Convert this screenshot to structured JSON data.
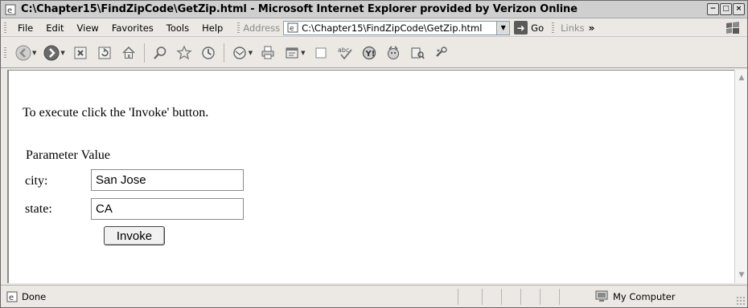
{
  "window": {
    "title": "C:\\Chapter15\\FindZipCode\\GetZip.html - Microsoft Internet Explorer provided by Verizon Online",
    "minimize_glyph": "−",
    "maximize_glyph": "□",
    "close_glyph": "×"
  },
  "menu": {
    "items": [
      "File",
      "Edit",
      "View",
      "Favorites",
      "Tools",
      "Help"
    ],
    "address_label": "Address",
    "address_value": "C:\\Chapter15\\FindZipCode\\GetZip.html",
    "go_label": "Go",
    "links_label": "Links",
    "more_glyph": "»"
  },
  "toolbar": {
    "buttons": [
      "back-icon",
      "forward-icon",
      "stop-icon",
      "refresh-icon",
      "home-icon",
      "search-icon",
      "favorites-icon",
      "history-icon",
      "mail-icon",
      "print-icon",
      "edit-icon",
      "discuss-icon",
      "spelling-icon",
      "messenger-icon",
      "yahoo-icon",
      "research-icon",
      "tools-icon"
    ]
  },
  "page": {
    "intro": "To execute click the 'Invoke' button.",
    "header_parameter": "Parameter",
    "header_value": "Value",
    "params": [
      {
        "label": "city:",
        "value": "San Jose"
      },
      {
        "label": "state:",
        "value": "CA"
      }
    ],
    "invoke_label": "Invoke"
  },
  "status": {
    "text": "Done",
    "zone": "My Computer"
  }
}
